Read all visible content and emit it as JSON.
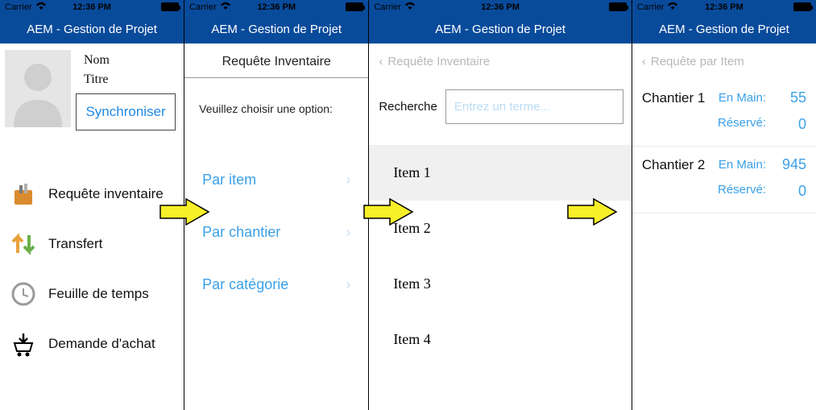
{
  "statusbar": {
    "carrier": "Carrier",
    "time": "12:36 PM"
  },
  "navbar": {
    "title": "AEM - Gestion de Projet"
  },
  "screen1": {
    "name_label": "Nom",
    "title_label": "Titre",
    "sync": "Synchroniser",
    "menu": [
      {
        "label": "Requête inventaire"
      },
      {
        "label": "Transfert"
      },
      {
        "label": "Feuille de temps"
      },
      {
        "label": "Demande d'achat"
      }
    ]
  },
  "screen2": {
    "header": "Requête Inventaire",
    "instruction": "Veuillez choisir une option:",
    "options": [
      {
        "label": "Par item"
      },
      {
        "label": "Par chantier"
      },
      {
        "label": "Par catégorie"
      }
    ]
  },
  "screen3": {
    "back": "Requête Inventaire",
    "search_label": "Recherche",
    "search_placeholder": "Entrez un terme...",
    "items": [
      "Item 1",
      "Item 2",
      "Item 3",
      "Item 4"
    ]
  },
  "screen4": {
    "back": "Requête par Item",
    "rows": [
      {
        "name": "Chantier 1",
        "onhand_label": "En Main:",
        "onhand": "55",
        "reserved_label": "Réservé:",
        "reserved": "0"
      },
      {
        "name": "Chantier 2",
        "onhand_label": "En Main:",
        "onhand": "945",
        "reserved_label": "Réservé:",
        "reserved": "0"
      }
    ]
  }
}
